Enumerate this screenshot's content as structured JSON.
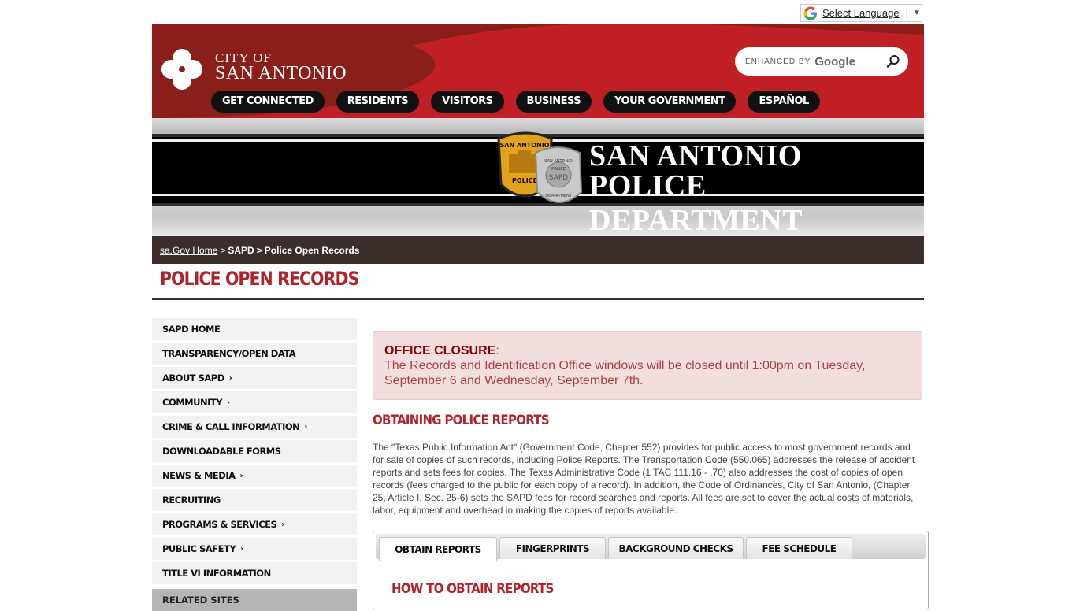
{
  "language": {
    "label": "Select Language"
  },
  "header": {
    "brand_line1": "CITY OF",
    "brand_line2": "SAN ANTONIO",
    "search_brand_prefix": "ENHANCED BY",
    "search_brand": "Google",
    "nav": [
      "GET CONNECTED",
      "RESIDENTS",
      "VISITORS",
      "BUSINESS",
      "YOUR GOVERNMENT",
      "ESPAÑOL"
    ]
  },
  "banner": {
    "title_line1": "SAN ANTONIO",
    "title_line2": "POLICE DEPARTMENT",
    "patch_top": "SAN ANTONIO",
    "patch_bottom": "POLICE",
    "badge_text1": "SAN ANTONIO",
    "badge_text2": "POLICE",
    "badge_text3": "SAPD",
    "badge_text4": "DEPARTMENT"
  },
  "breadcrumb": {
    "home": "sa.Gov Home",
    "sep": ">",
    "level1": "SAPD",
    "current": "Police Open Records"
  },
  "page_title": "POLICE OPEN RECORDS",
  "sidebar": {
    "items": [
      {
        "label": "SAPD HOME",
        "chevron": ""
      },
      {
        "label": "TRANSPARENCY/OPEN DATA",
        "chevron": ""
      },
      {
        "label": "ABOUT SAPD",
        "chevron": "›"
      },
      {
        "label": "COMMUNITY",
        "chevron": "›"
      },
      {
        "label": "CRIME & CALL INFORMATION",
        "chevron": "›"
      },
      {
        "label": "DOWNLOADABLE FORMS",
        "chevron": ""
      },
      {
        "label": "NEWS & MEDIA",
        "chevron": "›"
      },
      {
        "label": "RECRUITING",
        "chevron": ""
      },
      {
        "label": "PROGRAMS & SERVICES",
        "chevron": "›"
      },
      {
        "label": "PUBLIC SAFETY",
        "chevron": "›"
      },
      {
        "label": "TITLE VI INFORMATION",
        "chevron": ""
      }
    ],
    "related": "RELATED SITES"
  },
  "alert": {
    "heading": "OFFICE CLOSURE",
    "colon": ":",
    "message": "The Records and Identification Office windows will be closed until 1:00pm on Tuesday, September 6 and Wednesday, September 7th."
  },
  "section_title": "OBTAINING POLICE REPORTS",
  "intro": "The \"Texas Public Information Act\" (Government Code, Chapter 552) provides for public access to most government records and for sale of copies of such records, including Police Reports. The Transportation Code (550.065) addresses the release of accident reports and sets fees for copies. The Texas Administrative Code (1 TAC 111.16 - .70) also addresses the cost of copies of open records (fees charged to the public for each copy of a record). In addition, the Code of Ordinances, City of San Antonio, (Chapter 25, Article I, Sec. 25-6) sets the SAPD fees for record searches and reports. All fees are set to cover the actual costs of materials, labor, equipment and overhead in making the copies of reports available.",
  "tabs": {
    "items": [
      "OBTAIN REPORTS",
      "FINGERPRINTS",
      "BACKGROUND CHECKS",
      "FEE SCHEDULE"
    ],
    "active_heading": "HOW TO OBTAIN REPORTS"
  },
  "colors": {
    "brand_red": "#b1232a",
    "header_dark": "#8a1f1a",
    "header_bright": "#c11f26",
    "crumb_bg": "#3a2e2c"
  }
}
